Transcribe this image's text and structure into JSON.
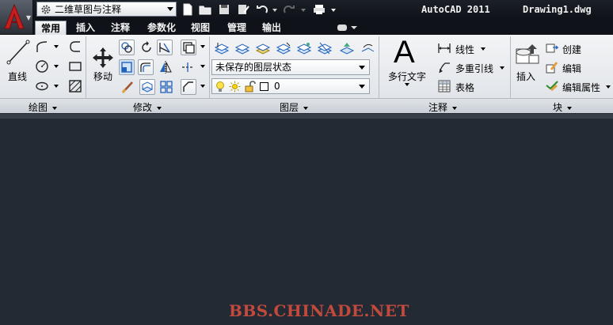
{
  "title_bar": {
    "workspace": "二维草图与注释",
    "app_name": "AutoCAD 2011",
    "document": "Drawing1.dwg"
  },
  "tabs": [
    "常用",
    "插入",
    "注释",
    "参数化",
    "视图",
    "管理",
    "输出"
  ],
  "panels": {
    "draw": {
      "title": "绘图",
      "line_label": "直线"
    },
    "modify": {
      "title": "修改",
      "move_label": "移动"
    },
    "layers": {
      "title": "图层",
      "state_combo": "未保存的图层状态",
      "layer_combo": "0"
    },
    "annotation": {
      "title": "注释",
      "mtext_label": "多行文字",
      "linear_label": "线性",
      "mleader_label": "多重引线",
      "table_label": "表格",
      "text_glyph": "A"
    },
    "block": {
      "title": "块",
      "insert_label": "插入",
      "create_label": "创建",
      "edit_label": "编辑",
      "edit_attr_label": "编辑属性"
    }
  },
  "watermark": "BBS.CHINADE.NET",
  "colors": {
    "titlebar": "#0e1117",
    "ribbon": "#e6e9ed",
    "canvas": "#232a33",
    "watermark": "#c24a3d",
    "accent_red": "#c41e1e"
  }
}
